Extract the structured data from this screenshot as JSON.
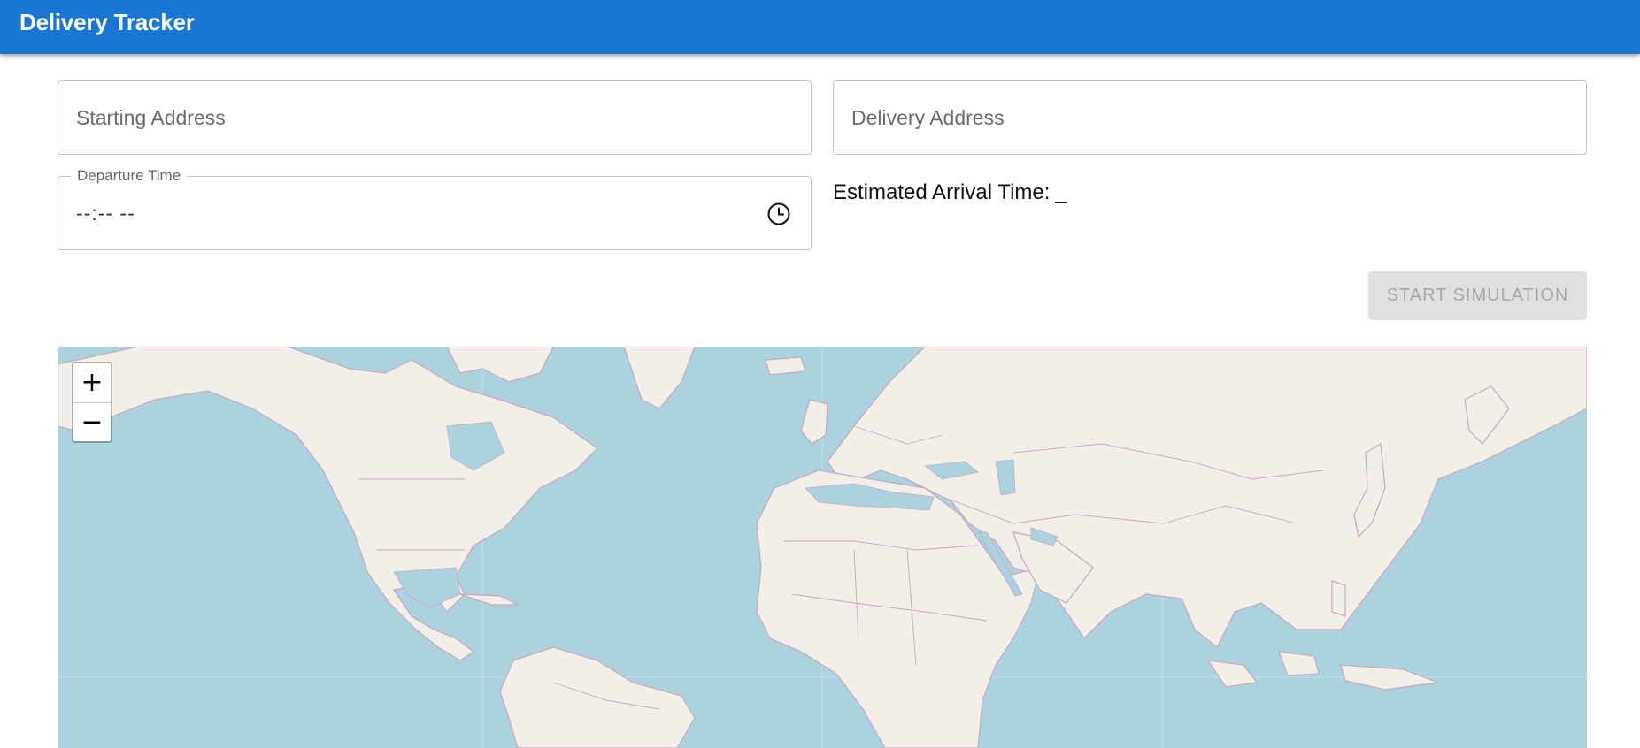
{
  "app": {
    "title": "Delivery Tracker"
  },
  "form": {
    "starting_address_placeholder": "Starting Address",
    "delivery_address_placeholder": "Delivery Address",
    "departure_time_label": "Departure Time",
    "departure_time_value": "--:-- --",
    "estimated_arrival_label": "Estimated Arrival Time:",
    "estimated_arrival_value": "_",
    "start_button_label": "Start Simulation",
    "start_button_disabled": true
  },
  "map": {
    "zoom_in_label": "+",
    "zoom_out_label": "−",
    "icons": {
      "clock": "clock-icon",
      "zoom_in": "plus-icon",
      "zoom_out": "minus-icon"
    }
  },
  "colors": {
    "primary": "#1976d2",
    "water": "#aad3df",
    "land": "#f2efe9",
    "border": "#c9a6bd",
    "button_disabled_bg": "#e0e0e0",
    "button_disabled_text": "#a6a6a6"
  }
}
